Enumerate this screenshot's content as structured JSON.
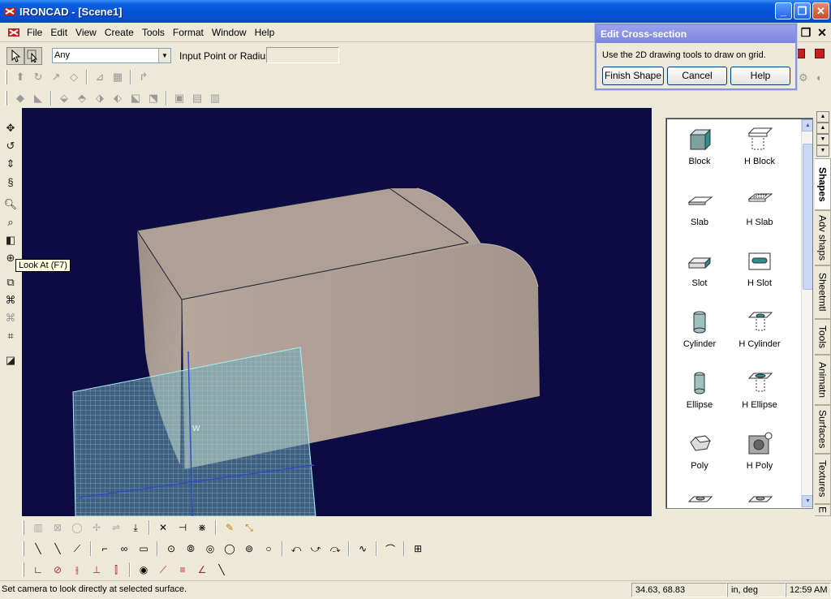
{
  "window": {
    "title": "IRONCAD - [Scene1]"
  },
  "menu": [
    "File",
    "Edit",
    "View",
    "Create",
    "Tools",
    "Format",
    "Window",
    "Help"
  ],
  "select_bar": {
    "filter_value": "Any",
    "input_label": "Input Point or Radius:",
    "input_value": ""
  },
  "tooltip": "Look At (F7)",
  "dialog": {
    "title": "Edit Cross-section",
    "message": "Use the 2D drawing tools to draw on grid.",
    "finish_label": "Finish Shape",
    "cancel_label": "Cancel",
    "help_label": "Help"
  },
  "catalog": {
    "items": [
      {
        "label": "Block",
        "icon": "block-icon"
      },
      {
        "label": "H Block",
        "icon": "h-block-icon"
      },
      {
        "label": "Slab",
        "icon": "slab-icon"
      },
      {
        "label": "H Slab",
        "icon": "h-slab-icon"
      },
      {
        "label": "Slot",
        "icon": "slot-icon"
      },
      {
        "label": "H Slot",
        "icon": "h-slot-icon"
      },
      {
        "label": "Cylinder",
        "icon": "cylinder-icon"
      },
      {
        "label": "H Cylinder",
        "icon": "h-cylinder-icon"
      },
      {
        "label": "Ellipse",
        "icon": "ellipse-icon"
      },
      {
        "label": "H Ellipse",
        "icon": "h-ellipse-icon"
      },
      {
        "label": "Poly",
        "icon": "poly-icon"
      },
      {
        "label": "H Poly",
        "icon": "h-poly-icon"
      }
    ],
    "tabs": [
      "Shapes",
      "Adv shaps",
      "Sheetmtl",
      "Tools",
      "Animatn",
      "Surfaces",
      "Textures",
      "E"
    ]
  },
  "viewport": {
    "grid_label": "W"
  },
  "status": {
    "message": "Set camera to look directly at selected surface.",
    "coords": "34.63, 68.83",
    "units": "in, deg",
    "time": "12:59 AM"
  },
  "colors": {
    "viewport_bg": "#0c0b44",
    "part_face": "#b3a49a",
    "grid": "#7fd3e0",
    "titlebar": "#0a5fe0"
  }
}
